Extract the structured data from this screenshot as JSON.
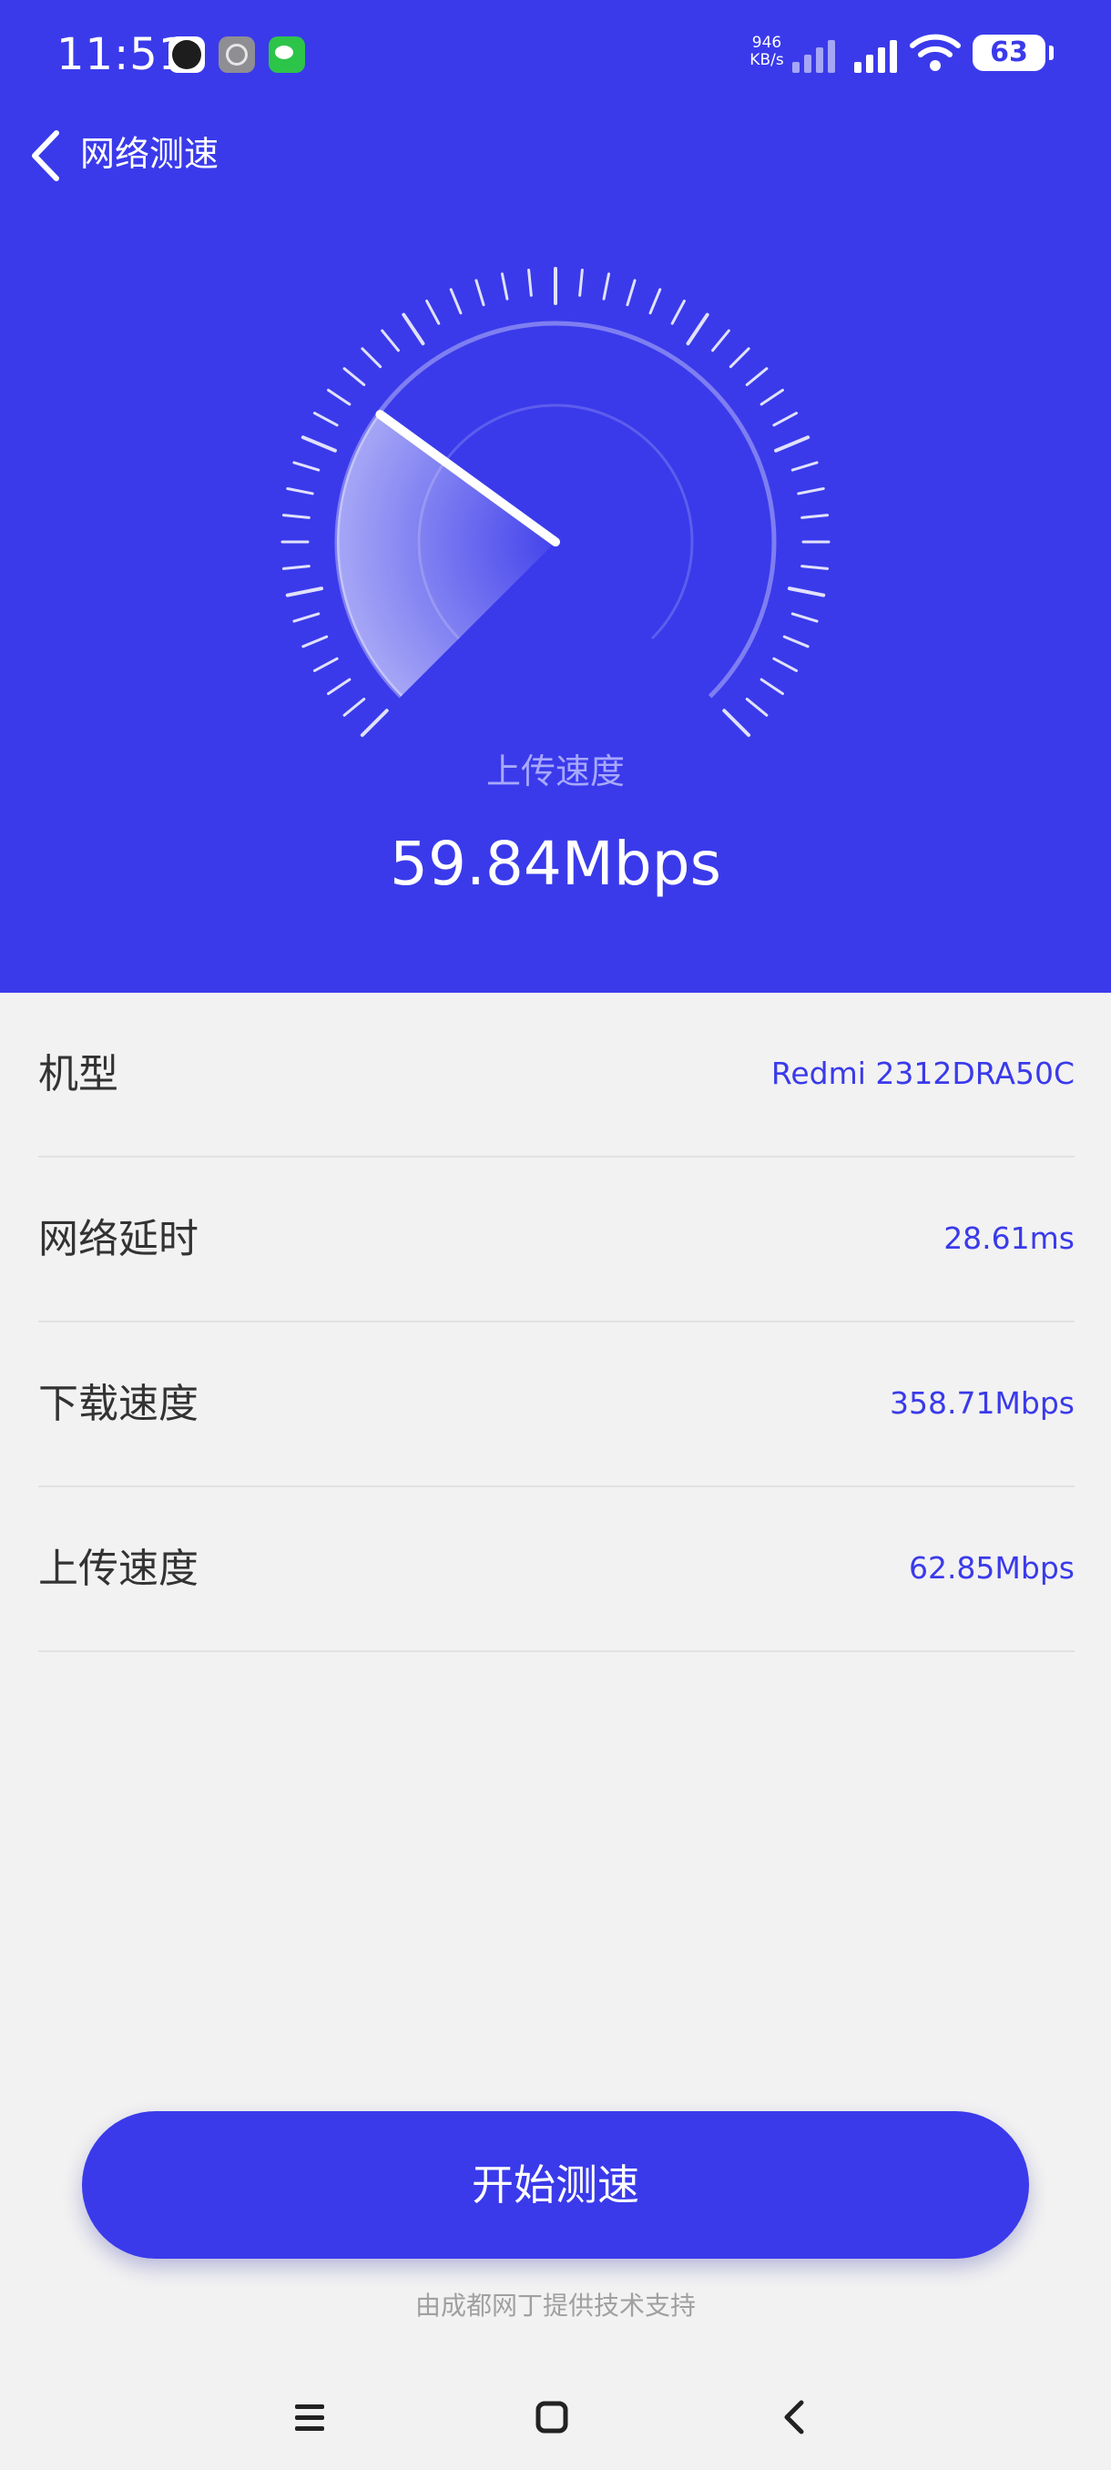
{
  "status_bar": {
    "time": "11:51",
    "net_speed_value": "946",
    "net_speed_unit": "KB/s",
    "battery": "63",
    "icons": [
      "clock-app-icon",
      "settings-app-icon",
      "wechat-app-icon",
      "signal-icon",
      "wifi-icon",
      "battery-icon"
    ]
  },
  "header": {
    "title": "网络测速",
    "back_icon": "chevron-left-icon"
  },
  "gauge": {
    "label": "上传速度",
    "value": "59.84Mbps",
    "needle_fraction": 0.3
  },
  "info": [
    {
      "label": "机型",
      "value": "Redmi 2312DRA50C"
    },
    {
      "label": "网络延时",
      "value": "28.61ms"
    },
    {
      "label": "下载速度",
      "value": "358.71Mbps"
    },
    {
      "label": "上传速度",
      "value": "62.85Mbps"
    }
  ],
  "start_button": {
    "label": "开始测速"
  },
  "footer": {
    "text": "由成都网丁提供技术支持"
  },
  "nav_bar": {
    "icons": [
      "menu-icon",
      "home-icon",
      "back-icon"
    ]
  },
  "colors": {
    "accent": "#3a3aeb",
    "background": "#f2f2f2",
    "value_text": "#3a3aeb"
  }
}
